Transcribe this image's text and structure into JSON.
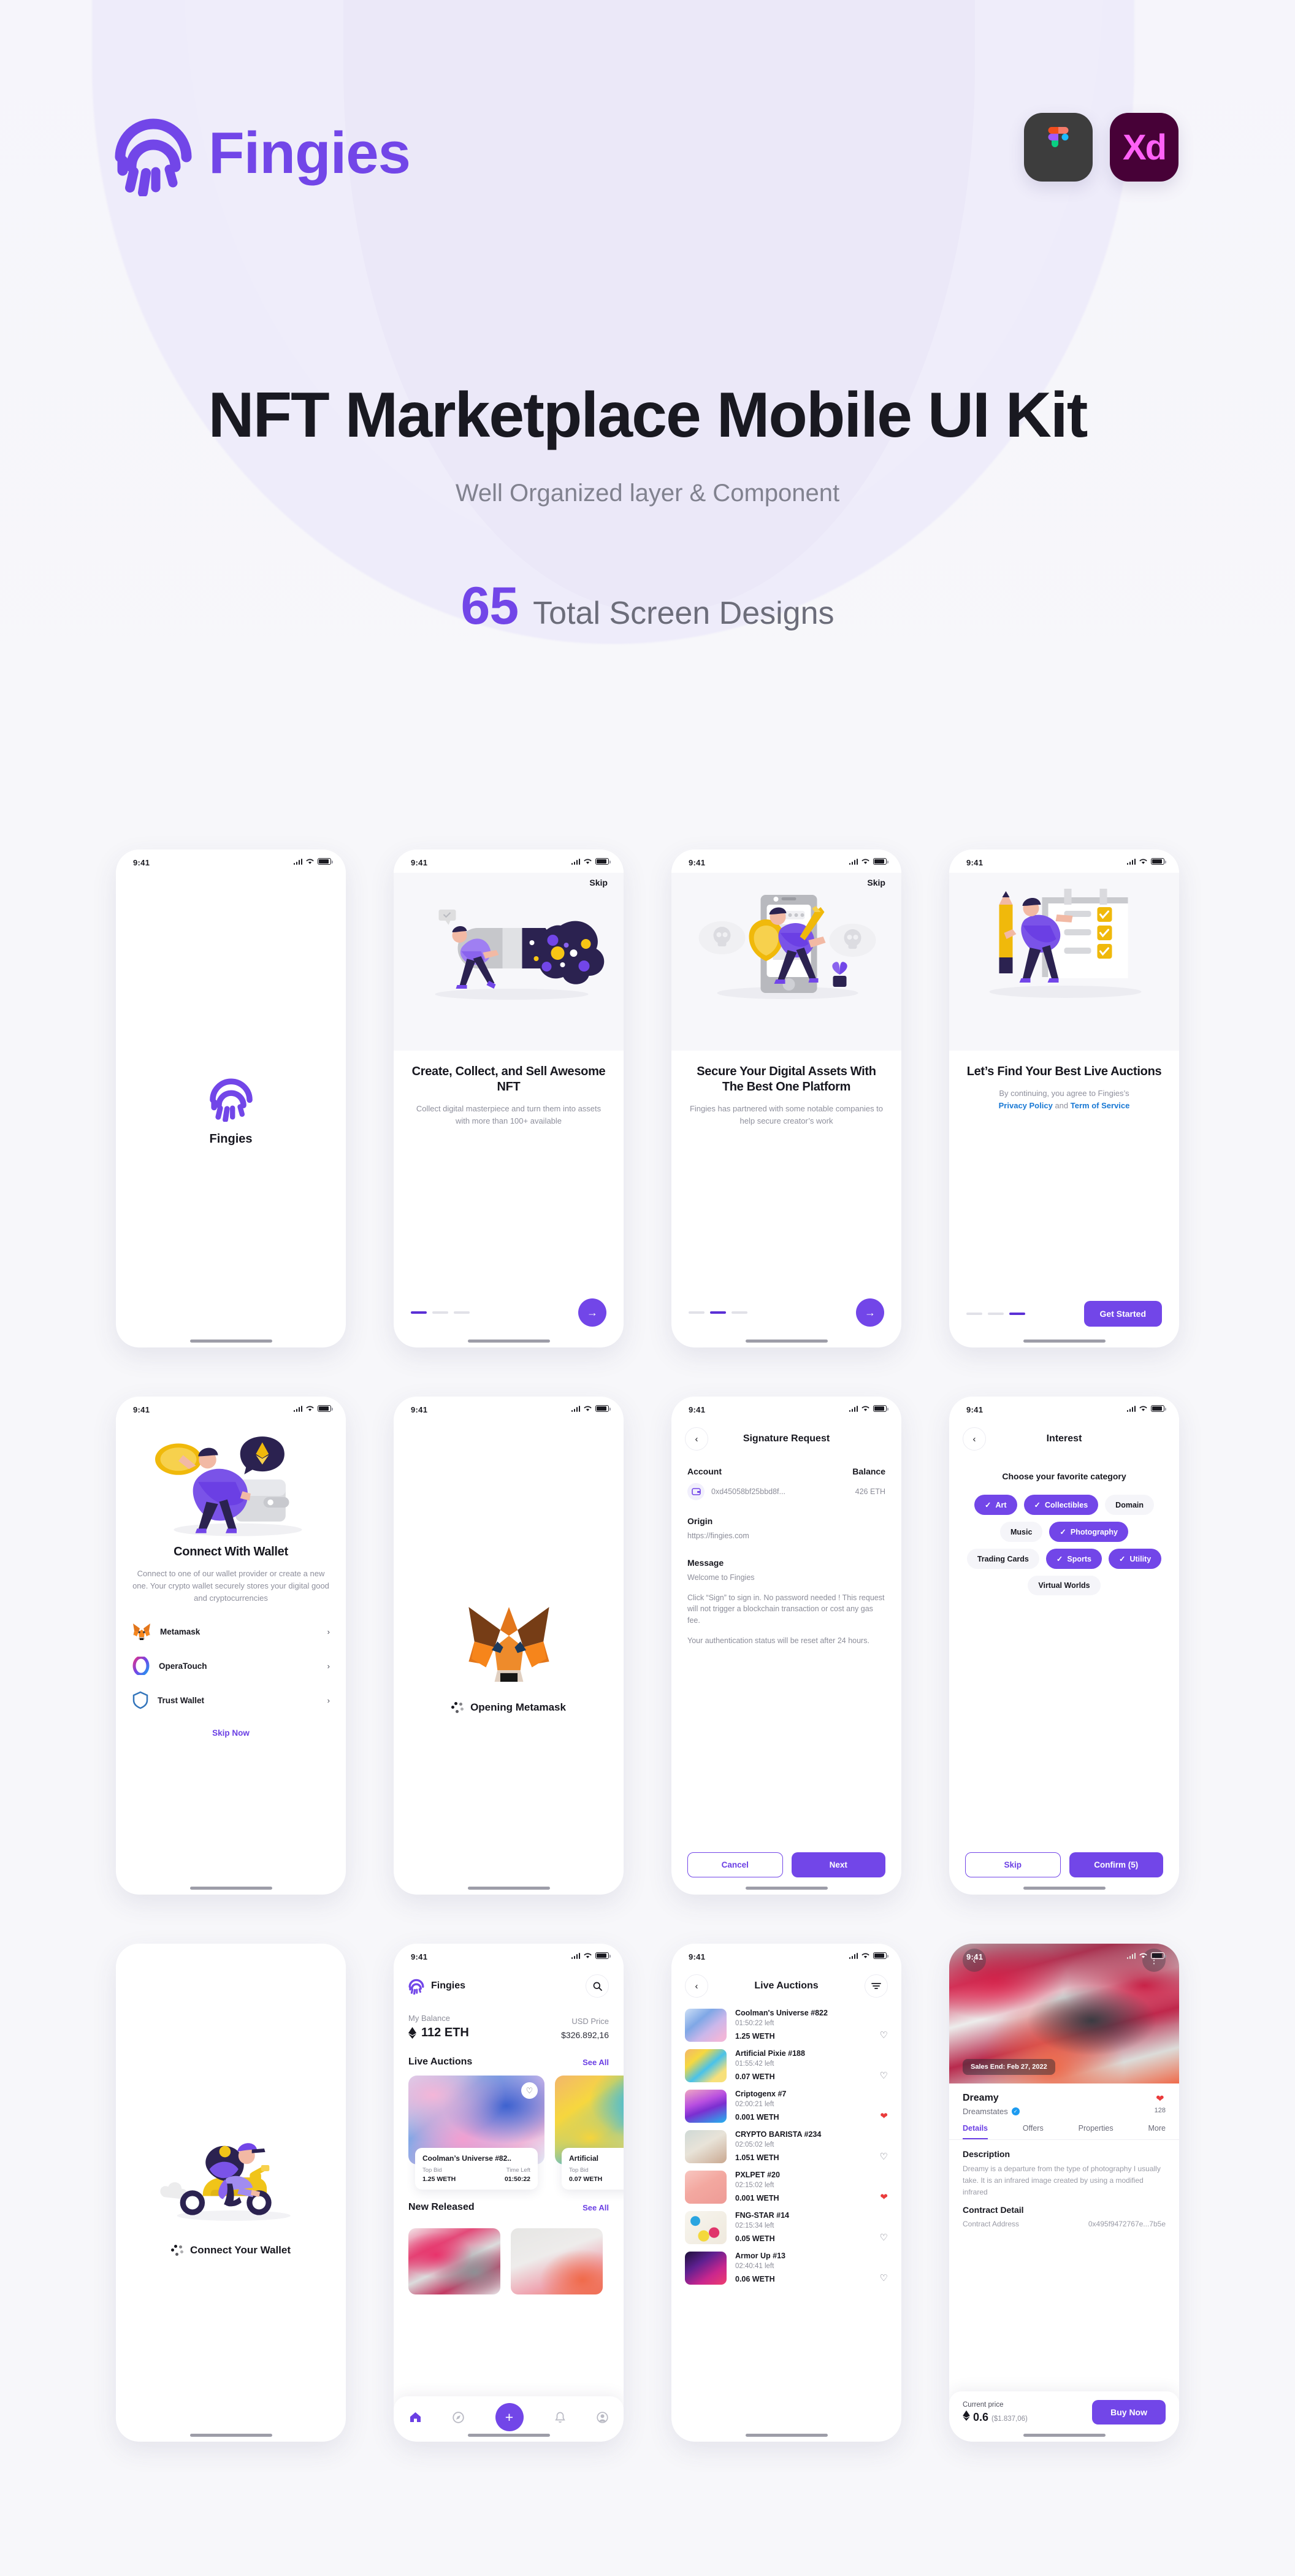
{
  "brand": {
    "name": "Fingies",
    "logo_icon": "fingerprint-icon",
    "accent": "#7246e8"
  },
  "tool_badges": [
    {
      "name": "figma-badge",
      "label": ""
    },
    {
      "name": "xd-badge",
      "label": "Xd"
    }
  ],
  "hero": {
    "title": "NFT Marketplace Mobile UI Kit",
    "subtitle": "Well Organized layer & Component",
    "count": "65",
    "count_label": "Total Screen Designs"
  },
  "status_bar": {
    "time": "9:41"
  },
  "screens": {
    "splash": {
      "app_name": "Fingies"
    },
    "onboard1": {
      "skip": "Skip",
      "title": "Create, Collect, and Sell Awesome NFT",
      "desc": "Collect digital masterpiece and turn them into assets with more than 100+ available"
    },
    "onboard2": {
      "skip": "Skip",
      "title": "Secure Your Digital Assets With The Best One Platform",
      "desc": "Fingies has partnered with some notable companies to help secure creator’s work"
    },
    "onboard3": {
      "title": "Let’s Find Your Best Live Auctions",
      "desc_pre": "By continuing, you agree to Fingies’s",
      "link1": "Privacy Policy",
      "desc_and": "and",
      "link2": "Term of Service",
      "cta": "Get Started"
    },
    "connect_wallet": {
      "title": "Connect With Wallet",
      "desc": "Connect to one of our wallet provider or create a new one. Your crypto wallet securely stores your digital good and cryptocurrencies",
      "wallets": [
        {
          "name": "Metamask",
          "icon": "metamask-fox-icon"
        },
        {
          "name": "OperaTouch",
          "icon": "opera-ring-icon"
        },
        {
          "name": "Trust Wallet",
          "icon": "trust-shield-icon"
        }
      ],
      "skip": "Skip Now"
    },
    "opening_metamask": {
      "label": "Opening Metamask"
    },
    "signature": {
      "title": "Signature Request",
      "account_label": "Account",
      "balance_label": "Balance",
      "account_value": "0xd45058bf25bbd8f...",
      "balance_value": "426 ETH",
      "origin_label": "Origin",
      "origin_value": "https://fingies.com",
      "message_label": "Message",
      "message_p1": "Welcome to Fingies",
      "message_p2": "Click “Sign” to sign in. No password needed ! This request will not trigger a blockchain transaction or cost any gas fee.",
      "message_p3": "Your authentication status will be reset after 24 hours.",
      "cancel": "Cancel",
      "next": "Next"
    },
    "interest": {
      "title": "Interest",
      "prompt": "Choose your favorite category",
      "chips": [
        {
          "label": "Art",
          "selected": true
        },
        {
          "label": "Collectibles",
          "selected": true
        },
        {
          "label": "Domain",
          "selected": false
        },
        {
          "label": "Music",
          "selected": false
        },
        {
          "label": "Photography",
          "selected": true
        },
        {
          "label": "Trading Cards",
          "selected": false
        },
        {
          "label": "Sports",
          "selected": true
        },
        {
          "label": "Utility",
          "selected": true
        },
        {
          "label": "Virtual Worlds",
          "selected": false
        }
      ],
      "skip": "Skip",
      "confirm": "Confirm (5)"
    },
    "connect_your_wallet": {
      "label": "Connect Your Wallet"
    },
    "home": {
      "brand": "Fingies",
      "search_icon": "search-icon",
      "balance_label": "My Balance",
      "balance_value": "112 ETH",
      "usd_label": "USD Price",
      "usd_value": "$326.892,16",
      "live_auctions_title": "Live Auctions",
      "see_all": "See All",
      "auction_cards": [
        {
          "name": "Coolman’s Universe #82..",
          "bid_label": "Top Bid",
          "bid": "1.25 WETH",
          "time_label": "Time Left",
          "time": "01:50:22"
        },
        {
          "name": "Artificial",
          "bid_label": "Top Bid",
          "bid": "0.07 WETH",
          "time_label": "Top Bid",
          "time": "0.07 WETH"
        }
      ],
      "new_released_title": "New Released",
      "tabs": [
        "home-icon",
        "compass-icon",
        "plus-icon",
        "bell-icon",
        "profile-icon"
      ]
    },
    "live_auctions": {
      "title": "Live Auctions",
      "filter_icon": "filter-icon",
      "items": [
        {
          "name": "Coolman's Universe #822",
          "time": "01:50:22 left",
          "price": "1.25 WETH",
          "liked": false
        },
        {
          "name": "Artificial Pixie #188",
          "time": "01:55:42 left",
          "price": "0.07 WETH",
          "liked": false
        },
        {
          "name": "Criptogenx #7",
          "time": "02:00:21 left",
          "price": "0.001 WETH",
          "liked": true
        },
        {
          "name": "CRYPTO BARISTA #234",
          "time": "02:05:02 left",
          "price": "1.051 WETH",
          "liked": false
        },
        {
          "name": "PXLPET #20",
          "time": "02:15:02 left",
          "price": "0.001 WETH",
          "liked": true
        },
        {
          "name": "FNG-STAR #14",
          "time": "02:15:34 left",
          "price": "0.05 WETH",
          "liked": false
        },
        {
          "name": "Armor Up #13",
          "time": "02:40:41 left",
          "price": "0.06 WETH",
          "liked": false
        }
      ]
    },
    "nft_detail": {
      "sales_end": "Sales End: Feb 27, 2022",
      "title": "Dreamy",
      "creator": "Dreamstates",
      "likes": "128",
      "tabs": [
        {
          "label": "Details",
          "active": true
        },
        {
          "label": "Offers",
          "active": false
        },
        {
          "label": "Properties",
          "active": false
        },
        {
          "label": "More",
          "active": false
        }
      ],
      "description_label": "Description",
      "description": "Dreamy is a departure from the type of photography I usually take. It is an infrared image created by using a modified infrared",
      "contract_label": "Contract Detail",
      "contract_address_key": "Contract Address",
      "contract_address_value": "0x495f9472767e...7b5e",
      "current_price_label": "Current price",
      "current_price_eth": "0.6",
      "current_price_usd": "($1.837,06)",
      "buy": "Buy Now"
    }
  }
}
